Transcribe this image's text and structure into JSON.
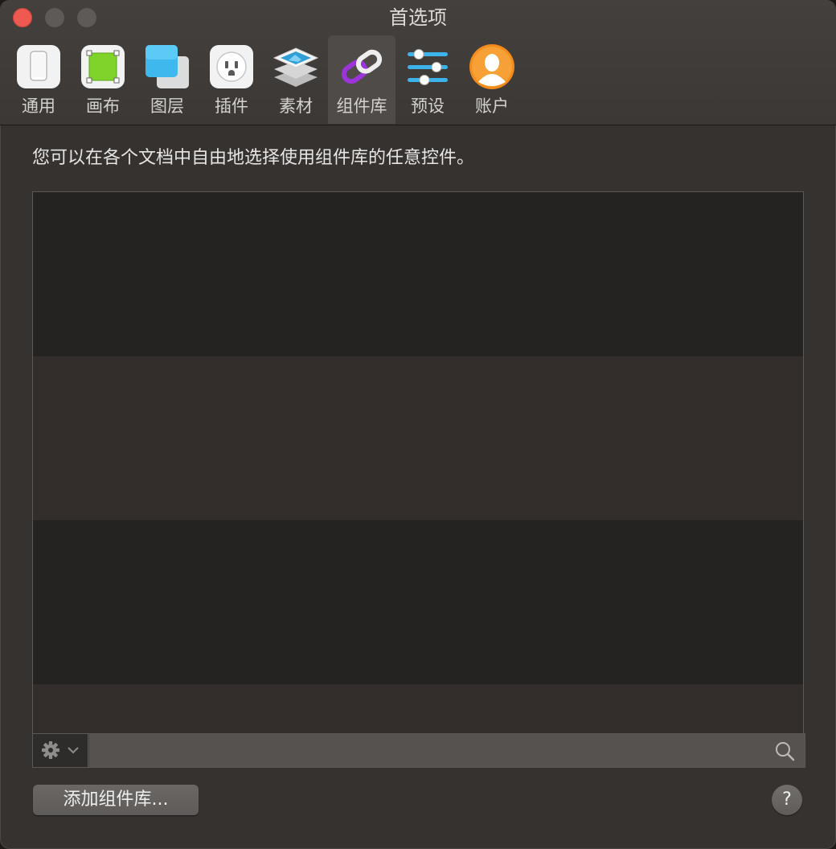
{
  "window": {
    "title": "首选项"
  },
  "toolbar": {
    "tabs": [
      {
        "label": "通用",
        "icon": "general-icon",
        "selected": false
      },
      {
        "label": "画布",
        "icon": "canvas-icon",
        "selected": false
      },
      {
        "label": "图层",
        "icon": "layers-icon",
        "selected": false
      },
      {
        "label": "插件",
        "icon": "plugin-icon",
        "selected": false
      },
      {
        "label": "素材",
        "icon": "assets-icon",
        "selected": false
      },
      {
        "label": "组件库",
        "icon": "libraries-icon",
        "selected": true
      },
      {
        "label": "预设",
        "icon": "presets-icon",
        "selected": false
      },
      {
        "label": "账户",
        "icon": "account-icon",
        "selected": false
      }
    ]
  },
  "main": {
    "description": "您可以在各个文档中自由地选择使用组件库的任意控件。",
    "add_library_label": "添加组件库...",
    "help_label": "?"
  },
  "colors": {
    "accent_close": "#ee5a52",
    "window_bg": "#353230",
    "list_row_dark": "#252321",
    "list_row_light": "#332e2b"
  }
}
